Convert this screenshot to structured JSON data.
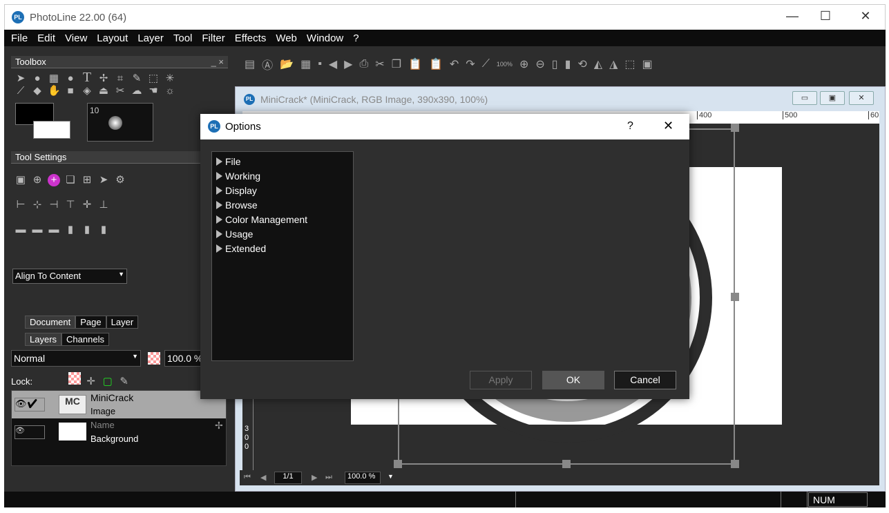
{
  "app": {
    "title": "PhotoLine 22.00 (64)",
    "logo": "PL"
  },
  "window_controls": {
    "minimize": "—",
    "maximize": "☐",
    "close": "✕"
  },
  "menu": [
    "File",
    "Edit",
    "View",
    "Layout",
    "Layer",
    "Tool",
    "Filter",
    "Effects",
    "Web",
    "Window",
    "?"
  ],
  "toolbox": {
    "title": "Toolbox",
    "brush_size": "10"
  },
  "tool_settings": {
    "title": "Tool Settings",
    "align_select": "Align To Content"
  },
  "panel_tabs": {
    "row1": [
      "Document",
      "Page",
      "Layer"
    ],
    "row2": [
      "Layers",
      "Channels"
    ]
  },
  "layers": {
    "blend_mode": "Normal",
    "opacity": "100.0 %",
    "lock_label": "Lock:",
    "items": [
      {
        "name": "MiniCrack",
        "type": "Image",
        "selected": true,
        "visible": true,
        "checked": true
      },
      {
        "name": "Name",
        "type": "Background",
        "selected": false,
        "visible": true,
        "checked": false
      }
    ]
  },
  "toolbar": {
    "zoom_label": "100%"
  },
  "document": {
    "title": "MiniCrack* (MiniCrack, RGB Image, 390x390, 100%)",
    "ruler_ticks": [
      "400",
      "500",
      "60"
    ],
    "vruler": [
      "3",
      "0",
      "0"
    ],
    "page": "1/1",
    "zoom": "100.0 %"
  },
  "dialog": {
    "title": "Options",
    "help": "?",
    "close": "✕",
    "tree": [
      "File",
      "Working",
      "Display",
      "Browse",
      "Color Management",
      "Usage",
      "Extended"
    ],
    "apply": "Apply",
    "ok": "OK",
    "cancel": "Cancel"
  },
  "statusbar": {
    "num": "NUM"
  },
  "colors": {
    "accent": "#1d6fb5",
    "panel": "#2d2d2d",
    "selected_layer": "#a8a8a8"
  }
}
